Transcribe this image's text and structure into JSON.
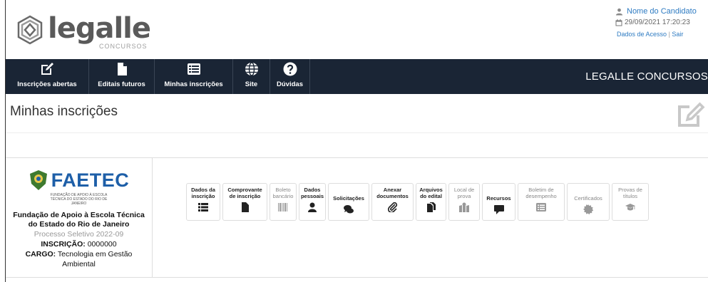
{
  "header": {
    "logo_text": "legalle",
    "logo_sub": "CONCURSOS",
    "user_name": "Nome do Candidato",
    "date_time": "29/09/2021 17:20:23",
    "link_access": "Dados de Acesso",
    "link_separator": "|",
    "link_exit": "Sair"
  },
  "nav": {
    "items": [
      {
        "label": "Inscrições abertas",
        "icon": "edit-icon"
      },
      {
        "label": "Editais futuros",
        "icon": "file-icon"
      },
      {
        "label": "Minhas inscrições",
        "icon": "list-icon"
      },
      {
        "label": "Site",
        "icon": "globe-icon"
      },
      {
        "label": "Dúvidas",
        "icon": "question-icon"
      }
    ],
    "brand": "LEGALLE CONCURSOS"
  },
  "page": {
    "title": "Minhas inscrições"
  },
  "card": {
    "org_logo_word": "FAETEC",
    "org_logo_small": "FUNDAÇÃO DE APOIO À ESCOLA TÉCNICA DO ESTADO DO RIO DE JANEIRO",
    "org_name_1": "Fundação de Apoio à Escola Técnica",
    "org_name_2": "do Estado do Rio de Janeiro",
    "process": "Processo Seletivo 2022-09",
    "inscription_label": "INSCRIÇÃO:",
    "inscription_value": "0000000",
    "cargo_label": "CARGO:",
    "cargo_value": "Tecnologia em Gestão Ambiental"
  },
  "actions": [
    {
      "label": "Dados da inscrição",
      "icon": "list-icon",
      "enabled": true
    },
    {
      "label": "Comprovante de inscrição",
      "icon": "file-icon",
      "enabled": true
    },
    {
      "label": "Boleto bancário",
      "icon": "barcode-icon",
      "enabled": false
    },
    {
      "label": "Dados pessoais",
      "icon": "user-icon",
      "enabled": true
    },
    {
      "label": "Solicitações",
      "icon": "comments-icon",
      "enabled": true
    },
    {
      "label": "Anexar documentos",
      "icon": "paperclip-icon",
      "enabled": true
    },
    {
      "label": "Arquivos do edital",
      "icon": "files-icon",
      "enabled": true
    },
    {
      "label": "Local de prova",
      "icon": "map-icon",
      "enabled": false
    },
    {
      "label": "Recursos",
      "icon": "comment-icon",
      "enabled": true
    },
    {
      "label": "Boletim de desempenho",
      "icon": "list-alt-icon",
      "enabled": false
    },
    {
      "label": "Certificados",
      "icon": "certificate-icon",
      "enabled": false
    },
    {
      "label": "Provas de títulos",
      "icon": "graduation-cap-icon",
      "enabled": false
    }
  ]
}
